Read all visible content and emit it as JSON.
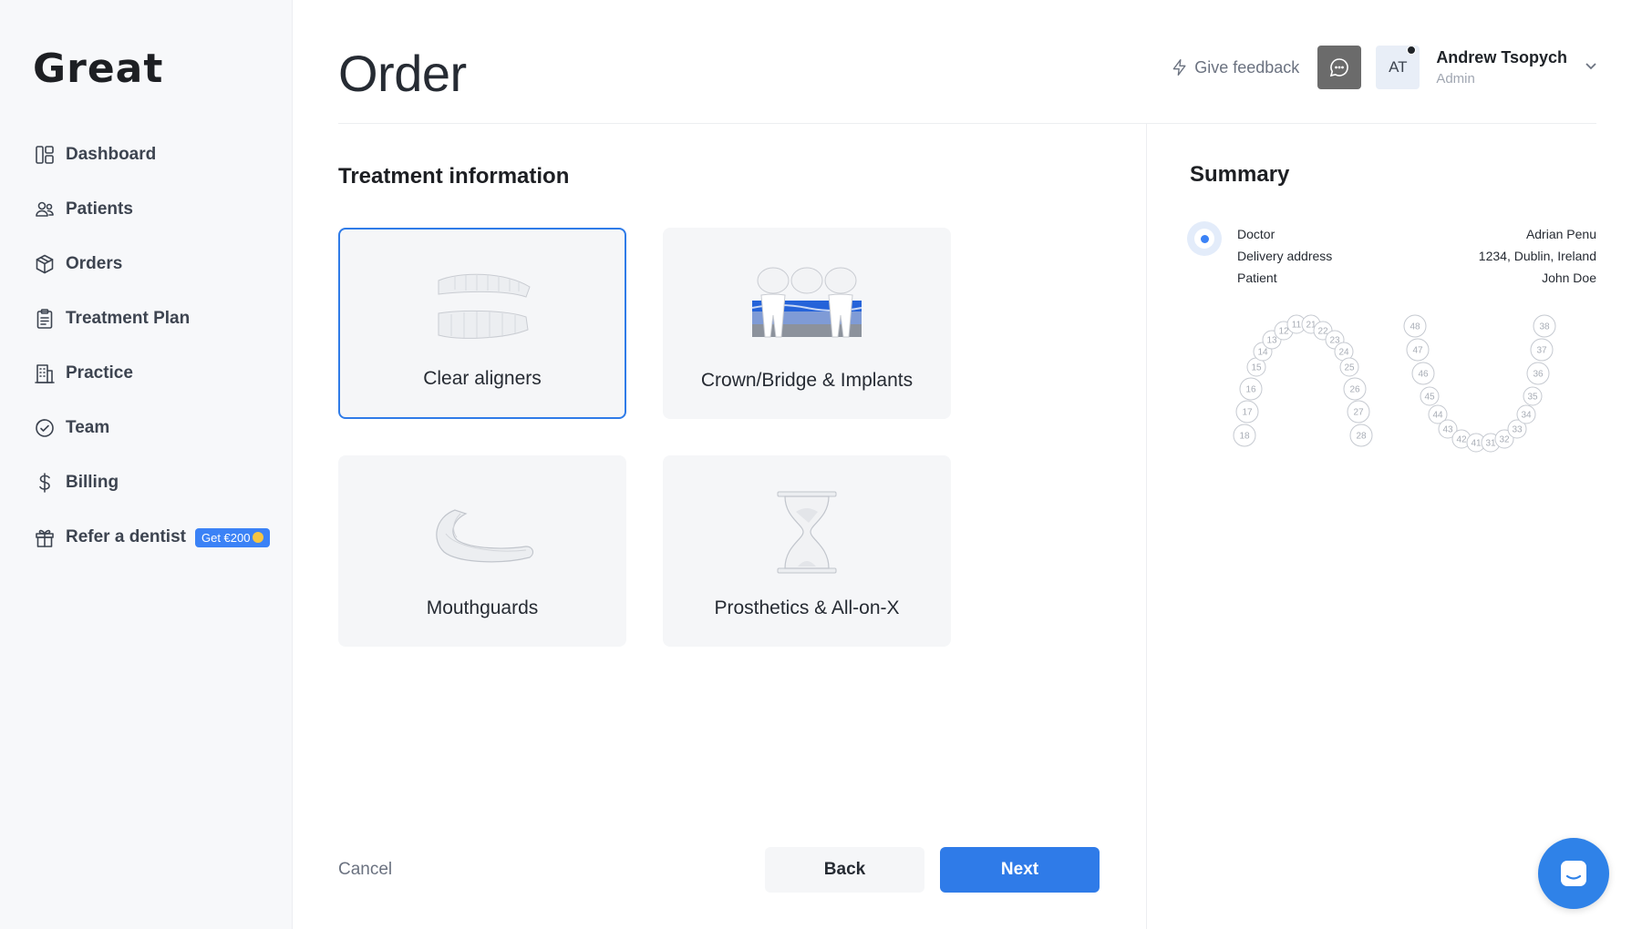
{
  "app": {
    "logo": "Great"
  },
  "sidebar": {
    "items": [
      {
        "label": "Dashboard",
        "icon": "dashboard-icon"
      },
      {
        "label": "Patients",
        "icon": "patients-icon"
      },
      {
        "label": "Orders",
        "icon": "box-icon"
      },
      {
        "label": "Treatment Plan",
        "icon": "clipboard-icon"
      },
      {
        "label": "Practice",
        "icon": "building-icon"
      },
      {
        "label": "Team",
        "icon": "team-icon"
      },
      {
        "label": "Billing",
        "icon": "dollar-icon"
      },
      {
        "label": "Refer a dentist",
        "icon": "gift-icon",
        "badge": "Get €200"
      }
    ]
  },
  "header": {
    "title": "Order",
    "feedback_label": "Give feedback",
    "avatar_initials": "AT",
    "user_name": "Andrew Tsopych",
    "user_role": "Admin"
  },
  "main": {
    "section_title": "Treatment information",
    "cards": [
      {
        "label": "Clear aligners",
        "selected": true
      },
      {
        "label": "Crown/Bridge & Implants",
        "selected": false
      },
      {
        "label": "Mouthguards",
        "selected": false
      },
      {
        "label": "Prosthetics & All-on-X",
        "selected": false
      }
    ],
    "cancel_label": "Cancel",
    "back_label": "Back",
    "next_label": "Next"
  },
  "summary": {
    "title": "Summary",
    "rows": [
      {
        "label": "Doctor",
        "value": "Adrian Penu"
      },
      {
        "label": "Delivery address",
        "value": "1234, Dublin, Ireland"
      },
      {
        "label": "Patient",
        "value": "John Doe"
      }
    ],
    "upper_teeth": [
      "18",
      "17",
      "16",
      "15",
      "14",
      "13",
      "12",
      "11",
      "21",
      "22",
      "23",
      "24",
      "25",
      "26",
      "27",
      "28"
    ],
    "lower_teeth": [
      "48",
      "47",
      "46",
      "45",
      "44",
      "43",
      "42",
      "41",
      "31",
      "32",
      "33",
      "34",
      "35",
      "36",
      "37",
      "38"
    ]
  },
  "colors": {
    "accent": "#2f7be8",
    "sidebar_bg": "#f7f8fa",
    "card_bg": "#f5f6f8"
  }
}
